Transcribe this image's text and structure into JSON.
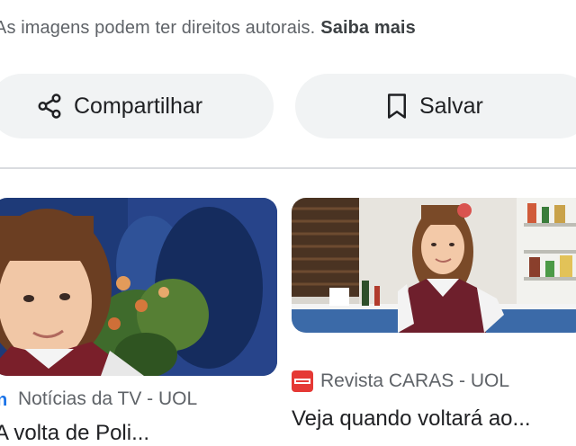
{
  "notice": {
    "text": "As imagens podem ter direitos autorais.",
    "learn_more": "Saiba mais"
  },
  "actions": {
    "share_label": "Compartilhar",
    "share_icon": "share-icon",
    "save_label": "Salvar",
    "save_icon": "bookmark-icon"
  },
  "results": [
    {
      "source": "Notícias da TV - UOL",
      "source_icon": "uol-logo-icon",
      "title": "A volta de Poli..."
    },
    {
      "source": "Revista CARAS - UOL",
      "source_icon": "caras-logo-icon",
      "title": "Veja quando voltará ao..."
    }
  ],
  "colors": {
    "pill_bg": "#f1f3f4",
    "muted_text": "#5f6368",
    "caras_red": "#e53935",
    "uol_blue": "#1a73e8"
  }
}
